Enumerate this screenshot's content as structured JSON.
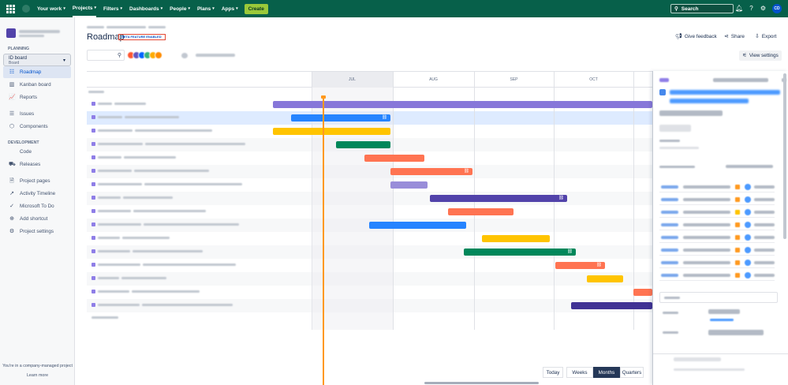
{
  "topnav": {
    "items": [
      {
        "label": "Your work",
        "chevron": true,
        "active": false
      },
      {
        "label": "Projects",
        "chevron": true,
        "active": true
      },
      {
        "label": "Filters",
        "chevron": true,
        "active": false
      },
      {
        "label": "Dashboards",
        "chevron": true,
        "active": false
      },
      {
        "label": "People",
        "chevron": true,
        "active": false
      },
      {
        "label": "Plans",
        "chevron": true,
        "active": false
      },
      {
        "label": "Apps",
        "chevron": true,
        "active": false
      }
    ],
    "create_label": "Create",
    "search_placeholder": "Search",
    "avatar_initials": "CD"
  },
  "sidebar": {
    "planning_label": "PLANNING",
    "board": {
      "name": "ID board",
      "type": "Board"
    },
    "planning_items": [
      {
        "label": "Roadmap",
        "icon": "roadmap-icon",
        "glyph": "☷",
        "active": true
      },
      {
        "label": "Kanban board",
        "icon": "kanban-icon",
        "glyph": "▥",
        "active": false
      },
      {
        "label": "Reports",
        "icon": "reports-icon",
        "glyph": "📈",
        "active": false
      }
    ],
    "other_items": [
      {
        "label": "Issues",
        "icon": "issues-icon",
        "glyph": "☰"
      },
      {
        "label": "Components",
        "icon": "components-icon",
        "glyph": "⬡"
      }
    ],
    "development_label": "DEVELOPMENT",
    "dev_items": [
      {
        "label": "Code",
        "icon": "code-icon",
        "glyph": "</>"
      },
      {
        "label": "Releases",
        "icon": "releases-icon",
        "glyph": "⛟"
      }
    ],
    "extra_items": [
      {
        "label": "Project pages",
        "icon": "pages-icon",
        "glyph": "🗎"
      },
      {
        "label": "Activity Timeline",
        "icon": "activity-icon",
        "glyph": "↗"
      },
      {
        "label": "Microsoft To Do",
        "icon": "todo-icon",
        "glyph": "✓"
      },
      {
        "label": "Add shortcut",
        "icon": "add-shortcut-icon",
        "glyph": "⊕"
      },
      {
        "label": "Project settings",
        "icon": "settings-icon",
        "glyph": "⚙"
      }
    ],
    "footer_text": "You're in a company-managed project",
    "footer_link": "Learn more"
  },
  "page": {
    "title": "Roadmap",
    "beta_label": "BETA FEATURE ENABLED",
    "give_feedback": "Give feedback",
    "share": "Share",
    "export": "Export",
    "view_settings": "View settings"
  },
  "timeline": {
    "months": [
      {
        "label": "",
        "current": false
      },
      {
        "label": "JUL",
        "current": true
      },
      {
        "label": "AUG",
        "current": false
      },
      {
        "label": "SEP",
        "current": false
      },
      {
        "label": "OCT",
        "current": false
      },
      {
        "label": "",
        "current": false
      }
    ],
    "bar_colors": {
      "purple": "#8777d9",
      "blue": "#2684ff",
      "yellow": "#ffc400",
      "green": "#00875a",
      "orange": "#ff7452",
      "lavender": "#998dd9",
      "indigo": "#5243aa",
      "navy": "#403294"
    }
  },
  "zoom": {
    "today": "Today",
    "options": [
      {
        "label": "Weeks",
        "active": false
      },
      {
        "label": "Months",
        "active": true
      },
      {
        "label": "Quarters",
        "active": false
      }
    ]
  }
}
